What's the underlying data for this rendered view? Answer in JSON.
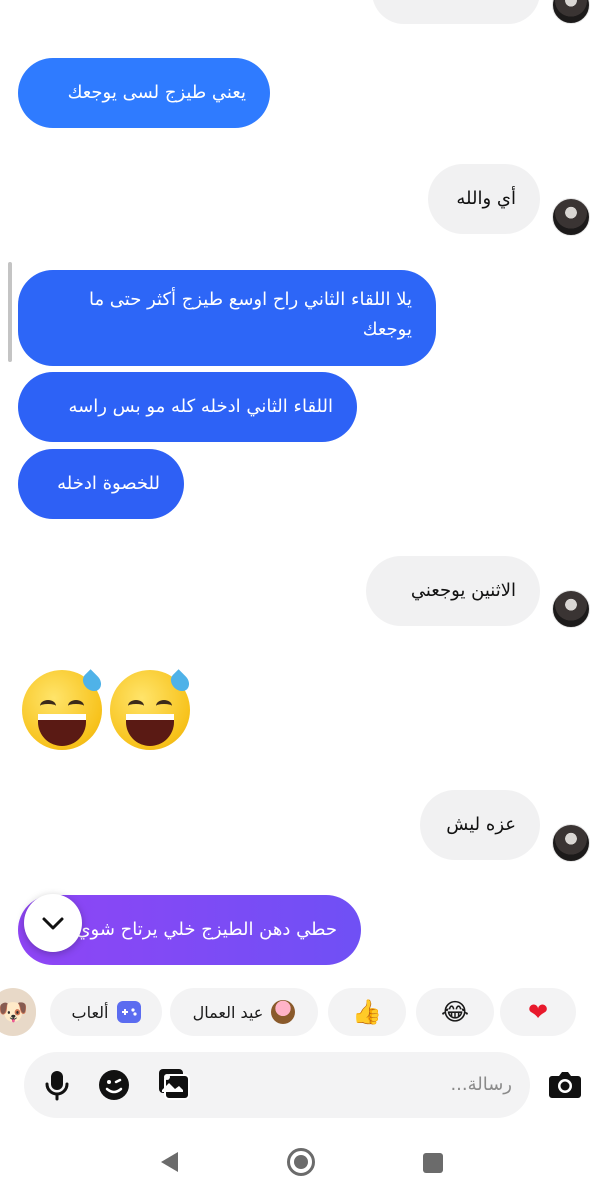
{
  "messages": {
    "m1": "يعني طيزج لسى يوجعك",
    "m2": "أي والله",
    "m3": "يلا اللقاء الثاني راح اوسع طيزج أكثر حتى ما يوجعك",
    "m4": "اللقاء الثاني ادخله كله مو بس راسه",
    "m5": "للخصوة ادخله",
    "m6": "الاثنين يوجعني",
    "m7": "عزه ليش",
    "m8": "حطي دهن الطيزج خلي يرتاح شوي"
  },
  "quick_replies": {
    "heart": "❤",
    "laugh": "😂",
    "thumbs": "👍",
    "labour_day": "عيد العمال",
    "games": "ألعاب"
  },
  "composer": {
    "placeholder": "رسالة..."
  },
  "colors": {
    "blue": "#2f7bff",
    "blue_deep": "#2d60f6",
    "purple": "#8f45f5",
    "incoming": "#f1f1f2"
  }
}
